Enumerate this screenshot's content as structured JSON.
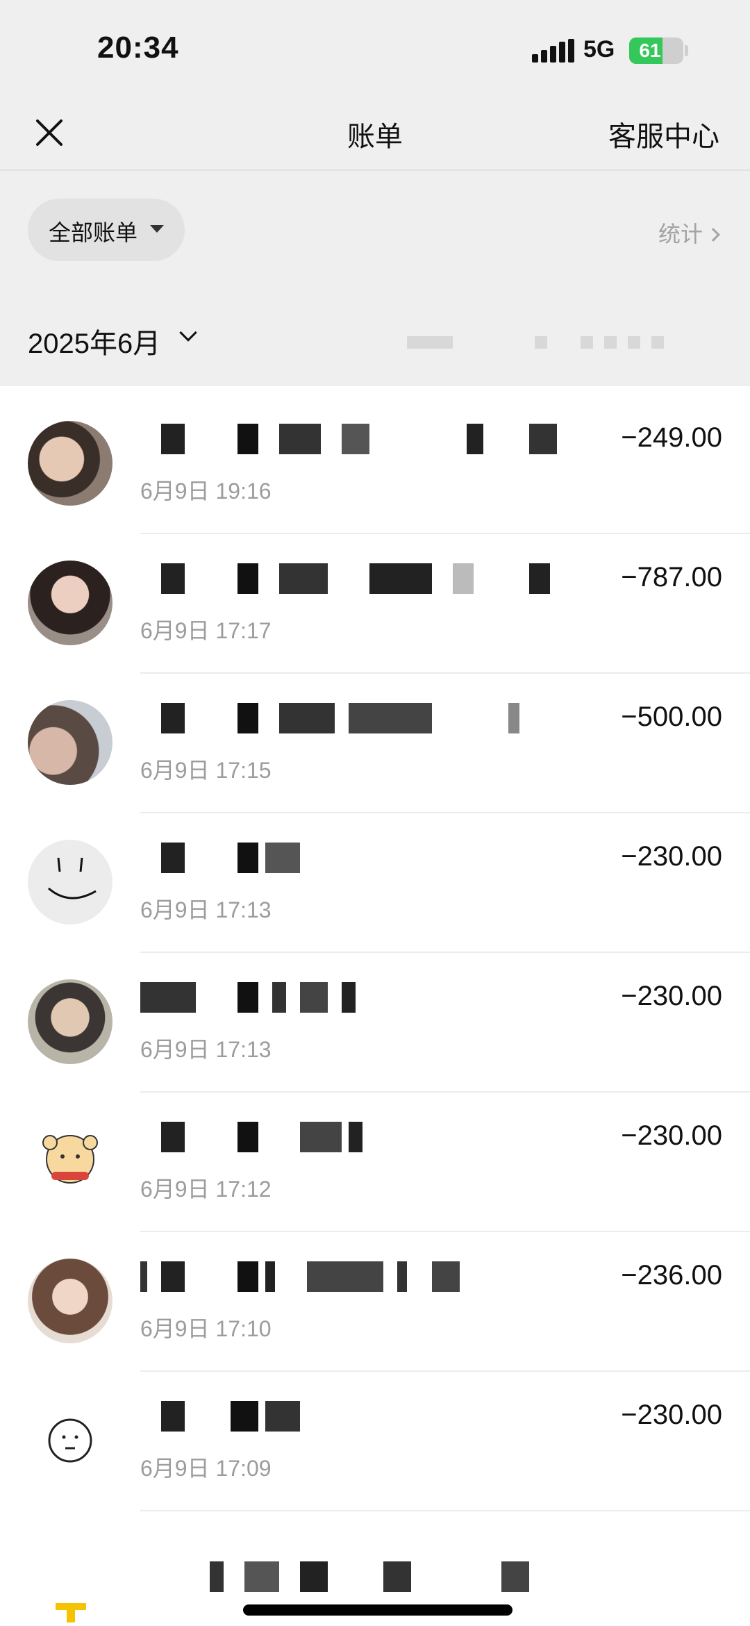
{
  "status_bar": {
    "time": "20:34",
    "network": "5G",
    "battery": "61",
    "battery_level": 0.61
  },
  "header": {
    "title": "账单",
    "right_link": "客服中心"
  },
  "filters": {
    "all_bills": "全部账单",
    "stats": "统计"
  },
  "month": "2025年6月",
  "transactions": [
    {
      "time": "6月9日 19:16",
      "amount": "−249.00",
      "avatar": "photo-avatar"
    },
    {
      "time": "6月9日 17:17",
      "amount": "−787.00",
      "avatar": "photo-avatar"
    },
    {
      "time": "6月9日 17:15",
      "amount": "−500.00",
      "avatar": "photo-avatar"
    },
    {
      "time": "6月9日 17:13",
      "amount": "−230.00",
      "avatar": "smiley-avatar"
    },
    {
      "time": "6月9日 17:13",
      "amount": "−230.00",
      "avatar": "photo-avatar"
    },
    {
      "time": "6月9日 17:12",
      "amount": "−230.00",
      "avatar": "bear-avatar"
    },
    {
      "time": "6月9日 17:10",
      "amount": "−236.00",
      "avatar": "photo-avatar"
    },
    {
      "time": "6月9日 17:09",
      "amount": "−230.00",
      "avatar": "face-outline-avatar"
    }
  ],
  "colors": {
    "header_bg": "#efefef",
    "battery_green": "#34c759",
    "secondary_text": "#9c9c9c",
    "accent_yellow": "#f5c400"
  }
}
